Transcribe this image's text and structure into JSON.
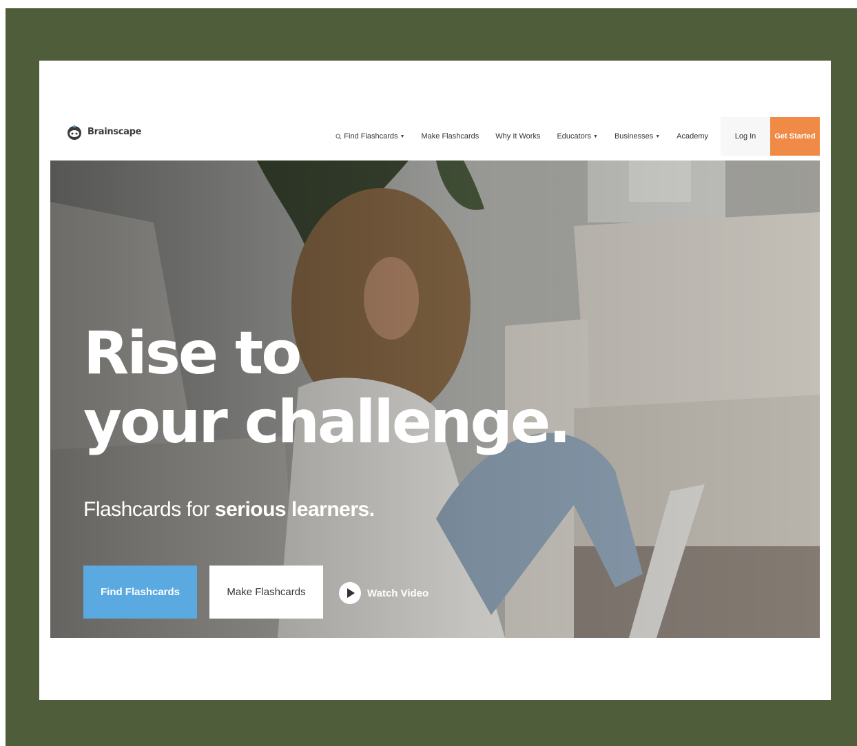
{
  "brand": {
    "name": "Brainscape"
  },
  "nav": {
    "items": [
      {
        "label": "Find Flashcards",
        "has_caret": true,
        "has_search_icon": true
      },
      {
        "label": "Make Flashcards",
        "has_caret": false
      },
      {
        "label": "Why It Works",
        "has_caret": false
      },
      {
        "label": "Educators",
        "has_caret": true
      },
      {
        "label": "Businesses",
        "has_caret": true
      },
      {
        "label": "Academy",
        "has_caret": false
      }
    ],
    "login_label": "Log In",
    "cta_label": "Get Started"
  },
  "hero": {
    "headline_line1": "Rise to",
    "headline_line2": "your challenge.",
    "sub_plain": "Flashcards for ",
    "sub_bold": "serious learners.",
    "find_button": "Find Flashcards",
    "make_button": "Make Flashcards",
    "watch_label": "Watch Video"
  },
  "colors": {
    "frame": "#4f5d3a",
    "accent_orange": "#ef8a47",
    "button_blue": "#5aa9e0"
  },
  "icons": {
    "logo": "brain-mascot-icon",
    "search": "search-icon",
    "caret": "caret-down-icon",
    "play": "play-icon"
  }
}
